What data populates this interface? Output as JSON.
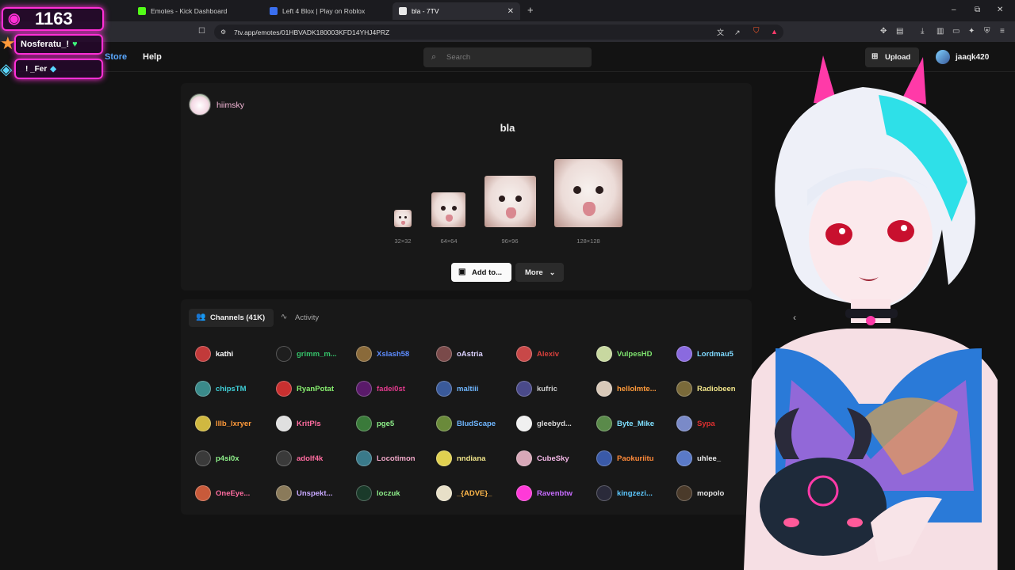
{
  "browser": {
    "tabs": [
      {
        "title": "Emotes - Kick Dashboard",
        "favicon_color": "#53fc18"
      },
      {
        "title": "Left 4 Blox | Play on Roblox",
        "favicon_color": "#3a6ff0"
      },
      {
        "title": "bla - 7TV",
        "favicon_color": "#ffffff"
      }
    ],
    "new_tab": "+",
    "url": "7tv.app/emotes/01HBVADK180003KFD14YHJ4PRZ"
  },
  "overlay": {
    "counter": "1163",
    "user1": "Nosferatu_!",
    "user2": "! _Fer"
  },
  "site": {
    "nav_store": "Store",
    "nav_help": "Help",
    "search_placeholder": "Search",
    "upload_label": "Upload",
    "username": "jaaqk420"
  },
  "emote": {
    "owner": "hiimsky",
    "name": "bla",
    "sizes": [
      "32×32",
      "64×64",
      "96×96",
      "128×128"
    ],
    "add_button": "Add to...",
    "more_button": "More"
  },
  "channels_tabs": {
    "channels": "Channels (41K)",
    "activity": "Activity"
  },
  "channels": [
    {
      "name": "kathi",
      "color": "#ffffff",
      "avatar": "#c23a3a"
    },
    {
      "name": "grimm_m...",
      "color": "#35c46a",
      "avatar": "#1e1e1e"
    },
    {
      "name": "Xslash58",
      "color": "#5d8cff",
      "avatar": "#8a6a3a"
    },
    {
      "name": "oAstria",
      "color": "#dcd2ff",
      "avatar": "#7a4a4a"
    },
    {
      "name": "Alexiv",
      "color": "#d8403c",
      "avatar": "#c84848"
    },
    {
      "name": "VulpesHD",
      "color": "#7ee26e",
      "avatar": "#c8d8a0"
    },
    {
      "name": "Lordmau5",
      "color": "#7fd9ff",
      "avatar": "#8a6adf"
    },
    {
      "name": "chipsTM",
      "color": "#3fd0d8",
      "avatar": "#3a8a8a"
    },
    {
      "name": "RyanPotat",
      "color": "#88f070",
      "avatar": "#c83030"
    },
    {
      "name": "fadei0st",
      "color": "#e43b8f",
      "avatar": "#5a1a6a"
    },
    {
      "name": "maltiii",
      "color": "#6fb6ff",
      "avatar": "#3a5a9a"
    },
    {
      "name": "kufric",
      "color": "#cfcfcf",
      "avatar": "#4a4a8a"
    },
    {
      "name": "hellolmte...",
      "color": "#ff9a3a",
      "avatar": "#d8c8b8"
    },
    {
      "name": "Radiobeen",
      "color": "#f1e58a",
      "avatar": "#7a6a3a"
    },
    {
      "name": "lllb_lxryer",
      "color": "#ff9a3a",
      "avatar": "#d0b840"
    },
    {
      "name": "KritPls",
      "color": "#ff6ca0",
      "avatar": "#e0e0e0"
    },
    {
      "name": "pge5",
      "color": "#8ef08a",
      "avatar": "#3a7a3a"
    },
    {
      "name": "BludScape",
      "color": "#6fb6ff",
      "avatar": "#6a8a3a"
    },
    {
      "name": "gleebyd...",
      "color": "#d9d9d9",
      "avatar": "#f0f0f0"
    },
    {
      "name": "Byte_Mike",
      "color": "#7fe0ff",
      "avatar": "#5a8a4a"
    },
    {
      "name": "Sypa",
      "color": "#e03030",
      "avatar": "#7a8ac8"
    },
    {
      "name": "p4si0x",
      "color": "#8ef08a",
      "avatar": "#3a3a3a"
    },
    {
      "name": "adolf4k",
      "color": "#ff6ca0",
      "avatar": "#3a3a3a"
    },
    {
      "name": "Locotimon",
      "color": "#f0a8c8",
      "avatar": "#3a7a8a"
    },
    {
      "name": "nndiana",
      "color": "#f1e58a",
      "avatar": "#e0d050"
    },
    {
      "name": "CubeSky",
      "color": "#f5b8e8",
      "avatar": "#d8a8b8"
    },
    {
      "name": "Paokuriitu",
      "color": "#ff8a3a",
      "avatar": "#3a5aa8"
    },
    {
      "name": "uhlee_",
      "color": "#e8e8e8",
      "avatar": "#5a7ac8"
    },
    {
      "name": "OneEye...",
      "color": "#ff6ca0",
      "avatar": "#c85a3a"
    },
    {
      "name": "Unspekt...",
      "color": "#c8a8ff",
      "avatar": "#8a7a5a"
    },
    {
      "name": "loczuk",
      "color": "#8ef08a",
      "avatar": "#1a3a2a"
    },
    {
      "name": "_{ADVE}_",
      "color": "#ffb84a",
      "avatar": "#e8e0c8"
    },
    {
      "name": "Ravenbtw",
      "color": "#c86cff",
      "avatar": "#ff3ad8"
    },
    {
      "name": "kingzezi...",
      "color": "#5cc8ff",
      "avatar": "#2a2a3a"
    },
    {
      "name": "mopolo",
      "color": "#e8e8e8",
      "avatar": "#4a3a2a"
    }
  ],
  "colors": {
    "accent_pink": "#ff2fd6",
    "store_link": "#5aa8ff",
    "page_bg": "#121212"
  }
}
